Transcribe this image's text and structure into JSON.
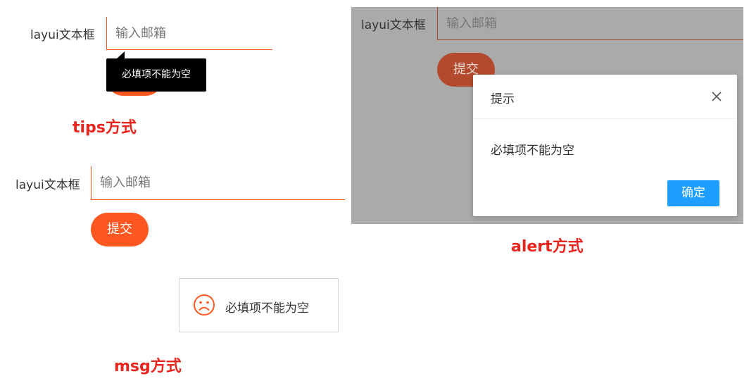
{
  "tips_demo": {
    "field_label": "layui文本框",
    "input_placeholder": "输入邮箱",
    "tip_text": "必填项不能为空",
    "caption": "tips方式"
  },
  "msg_demo": {
    "field_label": "layui文本框",
    "input_placeholder": "输入邮箱",
    "submit_label": "提交",
    "msg_text": "必填项不能为空",
    "msg_icon": "sad-face-icon",
    "caption": "msg方式"
  },
  "alert_demo": {
    "field_label": "layui文本框",
    "input_placeholder": "输入邮箱",
    "submit_label": "提交",
    "dialog_title": "提示",
    "dialog_message": "必填项不能为空",
    "confirm_label": "确定",
    "caption": "alert方式"
  },
  "colors": {
    "accent": "#ff5722",
    "caption_red": "#e8251e",
    "confirm_blue": "#1e9fff",
    "shade": "#aaaaaa"
  }
}
